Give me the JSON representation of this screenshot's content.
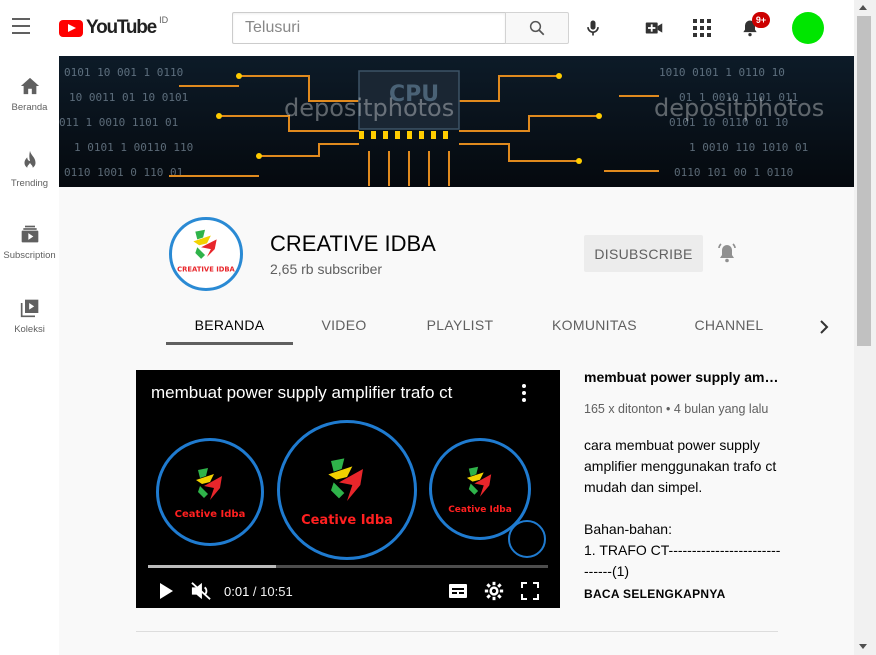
{
  "header": {
    "logo_text": "YouTube",
    "country_code": "ID",
    "search_placeholder": "Telusuri",
    "notification_count": "9+",
    "avatar_color": "#00e600"
  },
  "sidebar": {
    "items": [
      {
        "label": "Beranda",
        "icon": "home-icon"
      },
      {
        "label": "Trending",
        "icon": "fire-icon"
      },
      {
        "label": "Subscription",
        "icon": "subscriptions-icon"
      },
      {
        "label": "Koleksi",
        "icon": "library-icon"
      }
    ]
  },
  "banner": {
    "watermark_1": "depositphotos",
    "watermark_2": "depositphotos",
    "chip_label": "CPU"
  },
  "channel": {
    "name": "CREATIVE IDBA",
    "subscribers": "2,65 rb subscriber",
    "avatar_text": "CREATIVE IDBA",
    "unsubscribe_label": "DISUBSCRIBE"
  },
  "tabs": [
    {
      "label": "BERANDA",
      "active": true
    },
    {
      "label": "VIDEO",
      "active": false
    },
    {
      "label": "PLAYLIST",
      "active": false
    },
    {
      "label": "KOMUNITAS",
      "active": false
    },
    {
      "label": "CHANNEL",
      "active": false
    }
  ],
  "video": {
    "player_title": "membuat power supply amplifier trafo ct",
    "logo_text_left": "Ceative Idba",
    "logo_text_center": "Ceative Idba",
    "logo_text_right": "Ceative Idba",
    "progress": 0.32,
    "current_time": "0:01",
    "duration": "10:51",
    "title": "membuat power supply amplifier trafo ct",
    "meta": "165 x ditonton • 4 bulan yang lalu",
    "description_lines": [
      "cara membuat power supply amplifier menggunakan trafo ct mudah dan simpel.",
      "",
      "Bahan-bahan:",
      "1. TRAFO CT------------------------------(1)"
    ],
    "read_more": "BACA SELENGKAPNYA"
  }
}
